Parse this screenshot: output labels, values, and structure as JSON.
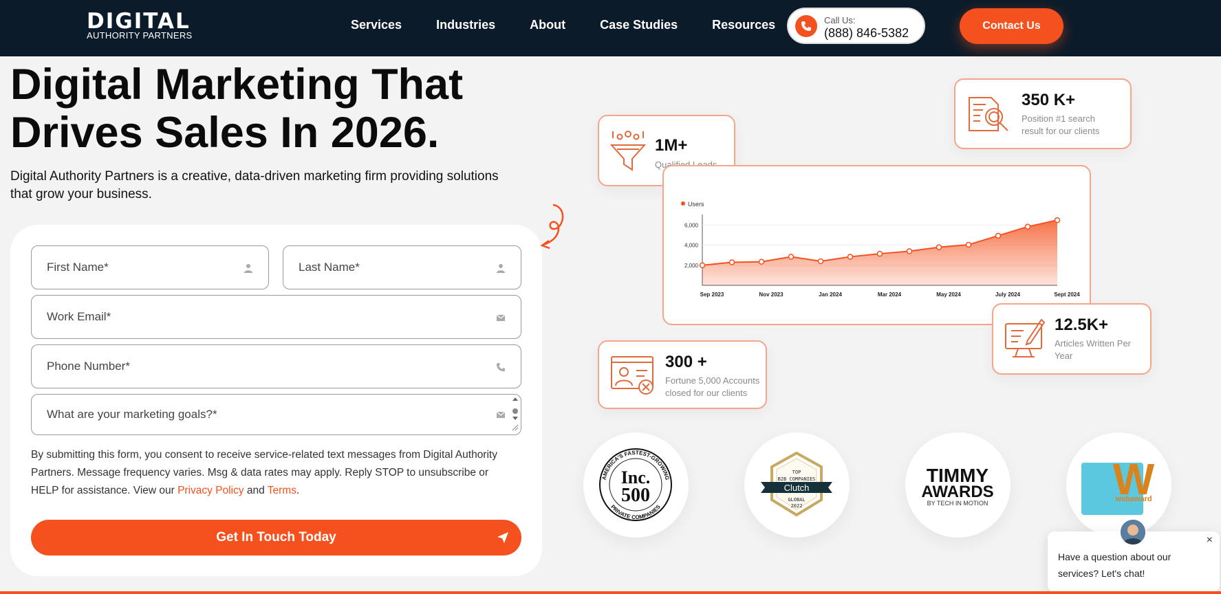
{
  "header": {
    "logo_main": "DIGITAL",
    "logo_sub": "AUTHORITY PARTNERS",
    "nav": [
      "Services",
      "Industries",
      "About",
      "Case Studies",
      "Resources"
    ],
    "call_label": "Call Us:",
    "call_number": "(888) 846-5382",
    "contact_label": "Contact Us"
  },
  "hero": {
    "title_line1": "Digital Marketing That",
    "title_line2": "Drives Sales In 2026.",
    "subtitle": "Digital Authority Partners is a creative, data-driven marketing firm providing solutions that grow your business."
  },
  "form": {
    "first_name": "First Name*",
    "last_name": "Last Name*",
    "email": "Work Email*",
    "phone": "Phone Number*",
    "goals": "What are your marketing goals?*",
    "consent_text": "By submitting this form, you consent to receive service-related text messages from Digital Authority Partners. Message frequency varies. Msg & data rates may apply. Reply STOP to unsubscribe or HELP for assistance. View our ",
    "privacy_link": "Privacy Policy",
    "and_text": " and ",
    "terms_link": "Terms",
    "period": ".",
    "submit_label": "Get In Touch Today"
  },
  "stats": {
    "leads_value": "1M+",
    "leads_label": "Qualified Leads",
    "search_value": "350 K+",
    "search_label_1": "Position #1 search",
    "search_label_2": "result for our clients",
    "articles_value": "12.5K+",
    "articles_label_1": "Articles Written Per",
    "articles_label_2": "Year",
    "accounts_value": "300 +",
    "accounts_label_1": "Fortune 5,000 Accounts",
    "accounts_label_2": "closed for our clients"
  },
  "chart_data": {
    "type": "area",
    "series": [
      {
        "name": "Users",
        "values": [
          2000,
          2300,
          2350,
          2850,
          2400,
          2850,
          3150,
          3400,
          3800,
          4050,
          4950,
          5850,
          6500
        ]
      }
    ],
    "x_tick_labels": [
      "Sep 2023",
      "Nov 2023",
      "Jan 2024",
      "Mar 2024",
      "May 2024",
      "July 2024",
      "Sept 2024"
    ],
    "y_tick_labels": [
      "2,000",
      "4,000",
      "6,000"
    ],
    "y_ticks": [
      2000,
      4000,
      6000
    ],
    "ylim": [
      0,
      7200
    ],
    "color": "#f4511e",
    "grid": true,
    "legend": "top-left"
  },
  "awards": {
    "inc_top": "AMERICA'S FASTEST-GROWING",
    "inc_main": "Inc.",
    "inc_num": "500",
    "inc_bottom": "PRIVATE COMPANIES",
    "clutch_top": "TOP",
    "clutch_b2b": "B2B COMPANIES",
    "clutch_name": "Clutch",
    "clutch_global": "GLOBAL",
    "clutch_year": "2022",
    "timmy_1": "TIMMY",
    "timmy_2": "AWARDS",
    "timmy_3": "BY TECH IN MOTION",
    "web_letter": "W",
    "web_name": "webaward"
  },
  "chat": {
    "text": "Have a question about our services? Let's chat!",
    "close": "×"
  },
  "colors": {
    "accent": "#f4511e",
    "header_bg": "#0c1b2a",
    "page_bg": "#f3f3f3"
  }
}
